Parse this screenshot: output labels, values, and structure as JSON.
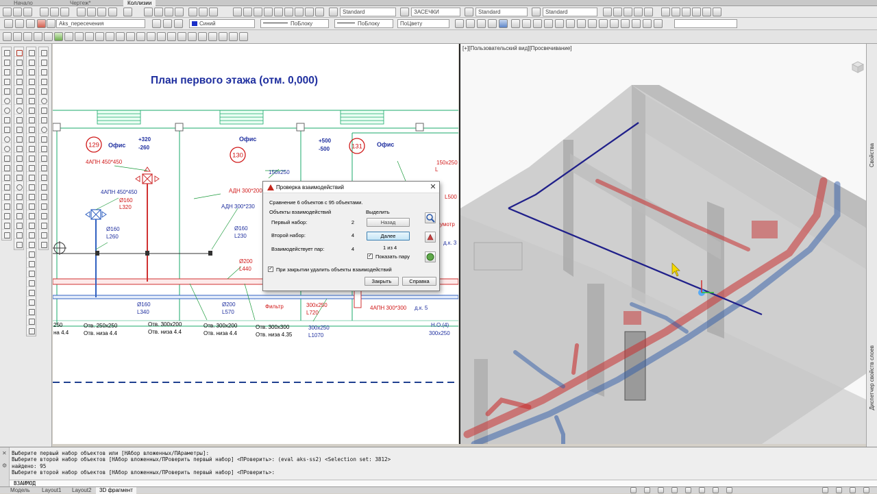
{
  "file_tabs": [
    "Начало",
    "Чертеж*",
    "Коллизии"
  ],
  "toolbar": {
    "textstyle": "Standard",
    "dimstyle": "ЗАСЕЧКИ",
    "tablestyle": "Standard",
    "mleaderstyle": "Standard",
    "layer": "Aks_пересечения",
    "color": "Синий",
    "linetype": "ПоБлоку",
    "lineweight": "ПоБлоку",
    "plotstyle": "ПоЦвету"
  },
  "plan": {
    "title": "План первого этажа (отм. 0,000)",
    "rooms": [
      {
        "number": "129",
        "name": "Офис"
      },
      {
        "number": "130",
        "name": "Офис"
      },
      {
        "number": "131",
        "name": "Офис"
      }
    ],
    "labels": [
      "+320",
      "-260",
      "+500",
      "-500",
      "4АПН 450*450",
      "4АПН 450*450",
      "АДН 300*200",
      "АДН 300*230",
      "Ø160",
      "L320",
      "Ø160",
      "L260",
      "Ø160",
      "L230",
      "150х250",
      "150х250",
      "L",
      "L500",
      "Ø200",
      "L440",
      "Ø160",
      "L340",
      "Ø200",
      "L570",
      "Фильтр",
      "300х250",
      "L720",
      "4АПН 300*300",
      "д.к. 5",
      "300х250",
      "L1070",
      "Отв. 250х250",
      "Отв. низа 4.4",
      "Отв. 300х200",
      "Отв. низа 4.4",
      "Отв. 300х200",
      "Отв. низа 4.4",
      "Отв. 300х300",
      "Отв. низа 4.35",
      "Н.О.(4)",
      "300х250",
      "250",
      "на 4.4",
      "д.к. 3",
      "умотр"
    ]
  },
  "viewport": {
    "label": "[+][Пользовательский вид][Просвечивание]"
  },
  "dialog": {
    "title": "Проверка взаимодействий",
    "summary": "Сравнение 6 объектов с 95 объектами.",
    "group_label": "Объекты взаимодействий",
    "rows": [
      {
        "label": "Первый набор:",
        "value": "2"
      },
      {
        "label": "Второй набор:",
        "value": "4"
      },
      {
        "label": "Взаимодействует пар:",
        "value": "4"
      }
    ],
    "highlight_label": "Выделить",
    "back": "Назад",
    "next": "Далее",
    "counter": "1 из 4",
    "show_pair": "Показать пару",
    "delete_on_close": "При закрытии удалить объекты взаимодействий",
    "close": "Закрыть",
    "help": "Справка"
  },
  "palettes": {
    "properties": "Свойства",
    "layer_manager": "Диспетчер свойств слоев"
  },
  "command": {
    "lines": [
      "Выберите первый набор объектов или [НАбор вложенных/ПАраметры]:",
      "Выберите второй набор объектов [НАбор вложенных/ПРоверить первый набор] <ПРоверить>: (eval aks-ss2) <Selection set: 3812>",
      "найдено: 95",
      "Выберите второй набор объектов [НАбор вложенных/ПРоверить первый набор] <ПРоверить>:"
    ],
    "input": "ВЗАИМОД"
  },
  "layout_tabs": [
    "Модель",
    "Layout1",
    "Layout2",
    "3D фрагмент"
  ],
  "colors": {
    "duct_red": "#c83030",
    "duct_blue": "#2f5ba8",
    "title_blue": "#1f2f9f",
    "plan_green": "#1a9a3a",
    "room_red": "#d01818"
  }
}
